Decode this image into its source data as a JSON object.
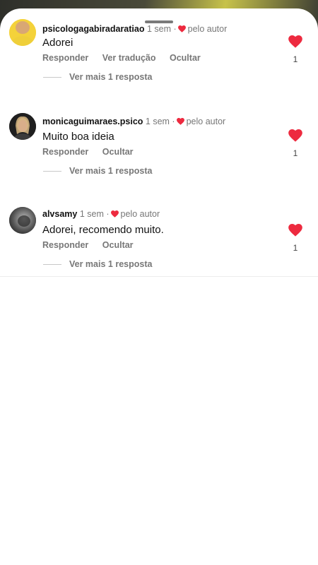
{
  "sheet": {
    "handle": "drag-handle"
  },
  "comments": [
    {
      "username": "psicologagabiradaratiao",
      "time": "1 sem",
      "liked_by_author": "pelo autor",
      "text": "Adorei",
      "actions": [
        "Responder",
        "Ver tradução",
        "Ocultar"
      ],
      "more_replies": "Ver mais 1 resposta",
      "likes": "1"
    },
    {
      "username": "monicaguimaraes.psico",
      "time": "1 sem",
      "liked_by_author": "pelo autor",
      "text": "Muito boa ideia",
      "actions": [
        "Responder",
        "Ocultar"
      ],
      "more_replies": "Ver mais 1 resposta",
      "likes": "1"
    },
    {
      "username": "alvsamy",
      "time": "1 sem",
      "liked_by_author": "pelo autor",
      "text": "Adorei, recomendo muito.",
      "actions": [
        "Responder",
        "Ocultar"
      ],
      "more_replies": "Ver mais 1 resposta",
      "likes": "1"
    }
  ],
  "colors": {
    "like_red": "#ed2a3f",
    "text_primary": "#111111",
    "text_secondary": "#777777"
  },
  "icons": {
    "like": "heart-icon",
    "author_like": "heart-mini-icon"
  }
}
